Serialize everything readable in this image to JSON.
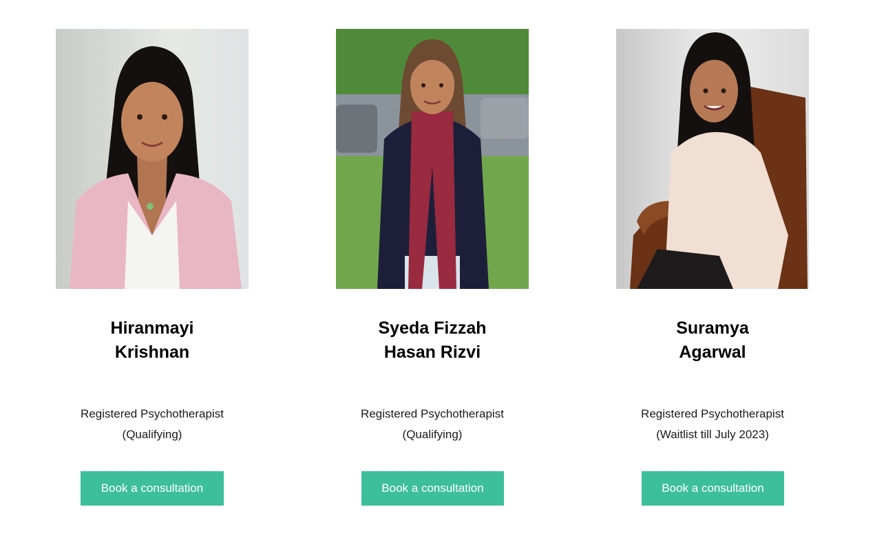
{
  "team": [
    {
      "name_line1": "Hiranmayi",
      "name_line2": "Krishnan",
      "role_line1": "Registered Psychotherapist",
      "role_line2": "(Qualifying)",
      "button_label": "Book a consultation"
    },
    {
      "name_line1": "Syeda Fizzah",
      "name_line2": "Hasan Rizvi",
      "role_line1": "Registered Psychotherapist",
      "role_line2": "(Qualifying)",
      "button_label": "Book a consultation"
    },
    {
      "name_line1": "Suramya",
      "name_line2": "Agarwal",
      "role_line1": "Registered Psychotherapist",
      "role_line2": "(Waitlist till July 2023)",
      "button_label": "Book a consultation"
    }
  ],
  "colors": {
    "button_bg": "#3dbf9b",
    "button_text": "#ffffff",
    "heading": "#000000",
    "body_text": "#1a1a1a"
  }
}
